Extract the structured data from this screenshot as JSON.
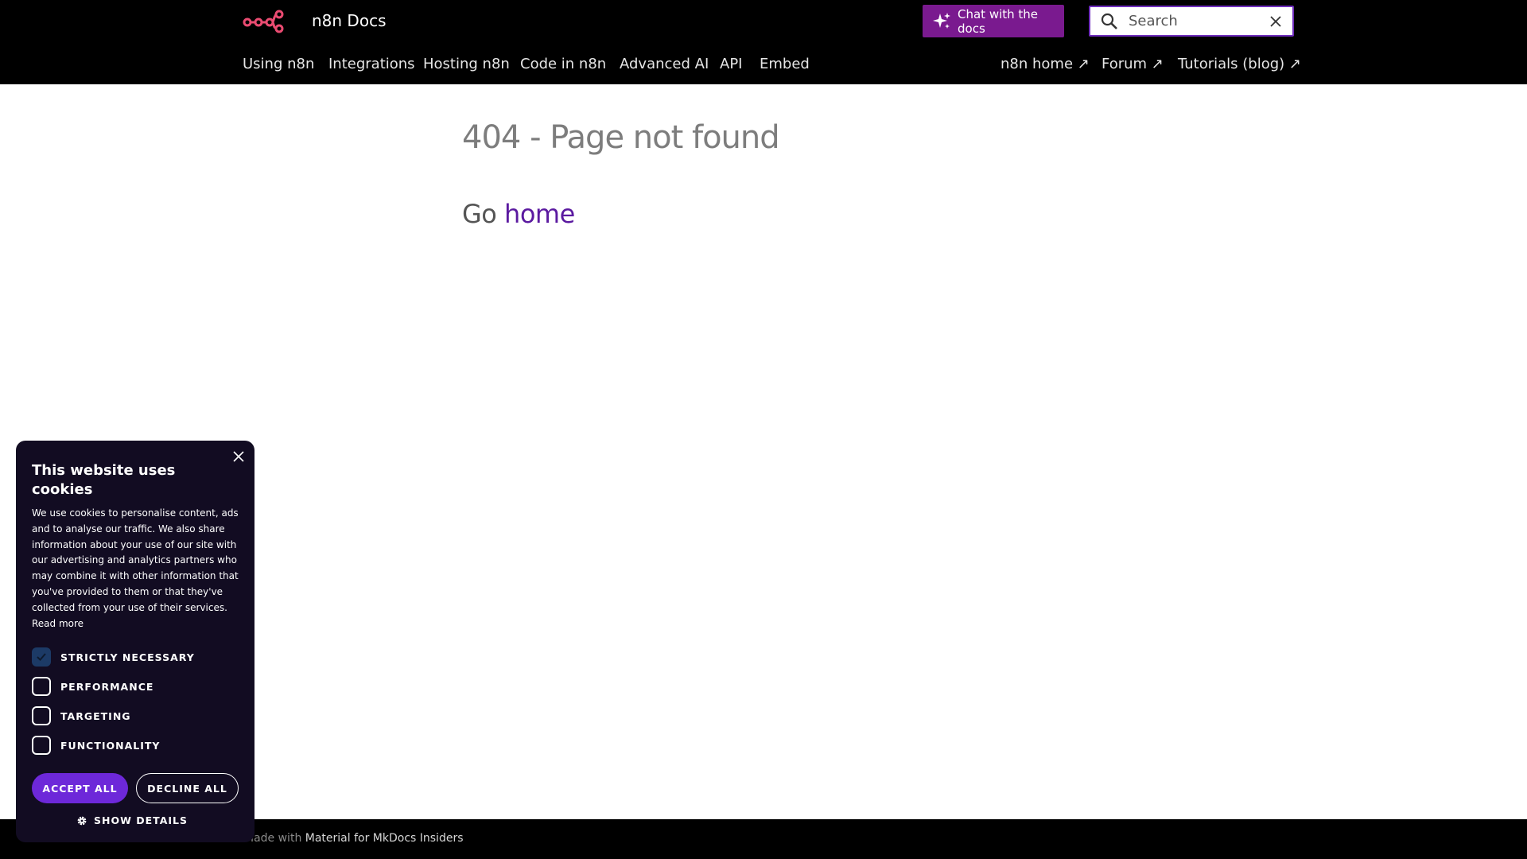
{
  "header": {
    "site_title": "n8n Docs",
    "chat_button_label": "Chat with the docs",
    "search_placeholder": "Search",
    "nav_left": [
      "Using n8n",
      "Integrations",
      "Hosting n8n",
      "Code in n8n",
      "Advanced AI",
      "API",
      "Embed"
    ],
    "nav_right": [
      "n8n home ↗",
      "Forum ↗",
      "Tutorials (blog) ↗"
    ],
    "logo_color": "#ea4b71",
    "chat_button_color": "#7a1a8f"
  },
  "main": {
    "title": "404 - Page not found",
    "go_prefix": "Go",
    "home_link": "home",
    "link_color": "#5b1aa0"
  },
  "footer": {
    "made_with": "Made with",
    "link": "Material for MkDocs Insiders"
  },
  "cookie_banner": {
    "title": "This website uses cookies",
    "description": "We use cookies to personalise content, ads and to analyse our traffic. We also share information about your use of our site with our advertising and analytics partners who may combine it with other information that you've provided to them or that they've collected from your use of their services.",
    "read_more": "Read more",
    "options": [
      {
        "label": "STRICTLY NECESSARY",
        "checked": true
      },
      {
        "label": "PERFORMANCE",
        "checked": false
      },
      {
        "label": "TARGETING",
        "checked": false
      },
      {
        "label": "FUNCTIONALITY",
        "checked": false
      }
    ],
    "accept_label": "ACCEPT ALL",
    "decline_label": "DECLINE ALL",
    "show_details_label": "SHOW DETAILS",
    "accent_color": "#6d28d9"
  }
}
